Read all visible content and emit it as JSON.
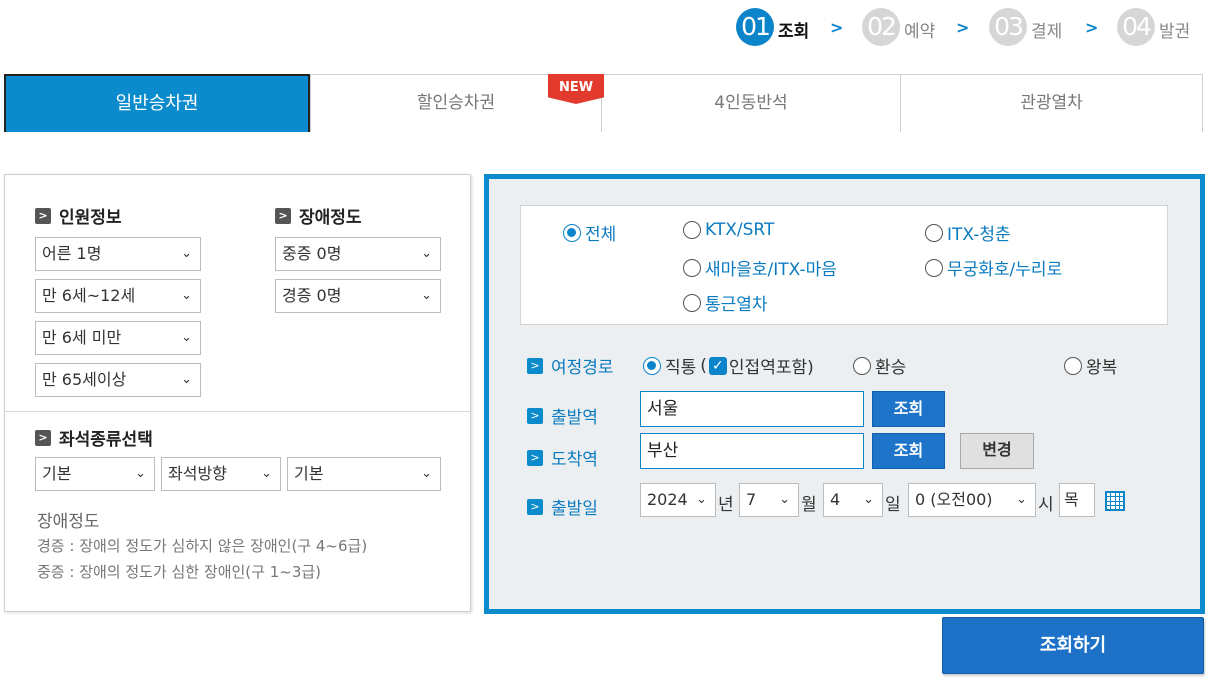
{
  "steps": [
    {
      "num": "01",
      "label": "조회"
    },
    {
      "num": "02",
      "label": "예약"
    },
    {
      "num": "03",
      "label": "결제"
    },
    {
      "num": "04",
      "label": "발권"
    }
  ],
  "tabs": [
    {
      "label": "일반승차권"
    },
    {
      "label": "할인승차권"
    },
    {
      "label": "4인동반석"
    },
    {
      "label": "관광열차"
    }
  ],
  "new_badge": "NEW",
  "passengers": {
    "title": "인원정보",
    "adult": "어른 1명",
    "child": "만 6세~12세",
    "infant": "만 6세 미만",
    "senior": "만 65세이상"
  },
  "disability": {
    "title": "장애정도",
    "severe": "중증 0명",
    "mild": "경증 0명"
  },
  "seat": {
    "title": "좌석종류선택",
    "type": "기본",
    "direction": "좌석방향",
    "option": "기본"
  },
  "disability_note": {
    "title": "장애정도",
    "mild": "경증 : 장애의 정도가 심하지 않은 장애인(구 4~6급)",
    "severe": "중증 : 장애의 정도가 심한 장애인(구 1~3급)"
  },
  "train_types": [
    {
      "label": "전체"
    },
    {
      "label": "KTX/SRT"
    },
    {
      "label": "ITX-청춘"
    },
    {
      "label": "새마을호/ITX-마음"
    },
    {
      "label": "무궁화호/누리로"
    },
    {
      "label": "통근열차"
    }
  ],
  "route": {
    "label": "여정경로",
    "direct": "직통",
    "include_nearby_open": "(",
    "include_nearby": "인접역포함)",
    "transfer": "환승",
    "round_trip": "왕복"
  },
  "departure": {
    "label": "출발역",
    "value": "서울",
    "button": "조회"
  },
  "arrival": {
    "label": "도착역",
    "value": "부산",
    "button": "조회",
    "swap_button": "변경"
  },
  "date": {
    "label": "출발일",
    "year": "2024",
    "year_unit": "년",
    "month": "7",
    "month_unit": "월",
    "day": "4",
    "day_unit": "일",
    "hour": "0 (오전00)",
    "hour_unit": "시",
    "weekday": "목"
  },
  "submit": "조회하기",
  "colors": {
    "accent": "#0b8bcc",
    "button": "#1d71c7",
    "badge": "#e23a2d"
  }
}
